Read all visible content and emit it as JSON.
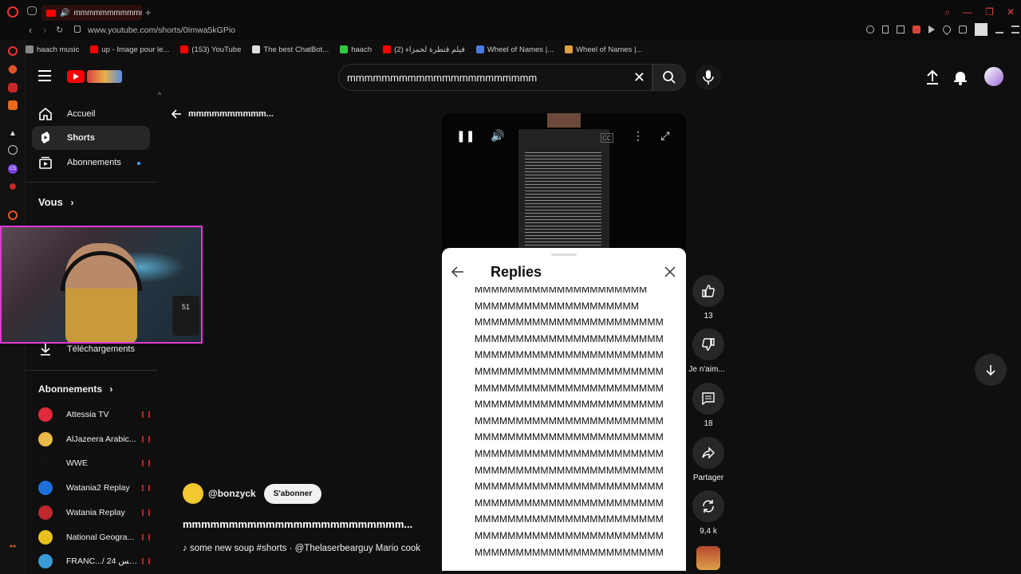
{
  "browser": {
    "tab_title": "mmmmmmmmmmmm",
    "url": "www.youtube.com/shorts/0Imwa5kGPio",
    "bookmarks": [
      {
        "label": "haach music",
        "color": "#888888"
      },
      {
        "label": "up - Image pour le...",
        "color": "#ff0000"
      },
      {
        "label": "(153) YouTube",
        "color": "#ff0000"
      },
      {
        "label": "The best ChatBot...",
        "color": "#dddddd"
      },
      {
        "label": "haach",
        "color": "#2ecc40"
      },
      {
        "label": "فيلم قنطرة لحمزاء (2)",
        "color": "#ff0000"
      },
      {
        "label": "Wheel of Names |...",
        "color": "#4a7de0"
      },
      {
        "label": "Wheel of Names |...",
        "color": "#e0a040"
      }
    ]
  },
  "header": {
    "search_query": "mmmmmmmmmmmmmmmmmmmmmm"
  },
  "sidebar": {
    "items": [
      {
        "label": "Accueil"
      },
      {
        "label": "Shorts"
      },
      {
        "label": "Abonnements"
      }
    ],
    "you_label": "Vous",
    "downloads_label": "Téléchargements",
    "subscriptions_label": "Abonnements",
    "channels": [
      {
        "name": "Attessia TV",
        "color": "#e0293a"
      },
      {
        "name": "AlJazeera Arabic...",
        "color": "#e9b949"
      },
      {
        "name": "WWE",
        "color": "#111111"
      },
      {
        "name": "Watania2 Replay",
        "color": "#1e6fd9"
      },
      {
        "name": "Watania Replay",
        "color": "#c0282d"
      },
      {
        "name": "National Geogra...",
        "color": "#e8c21c"
      },
      {
        "name": "FRANC.../ قرانس 24",
        "color": "#3a9bd6"
      }
    ]
  },
  "webcam": {
    "device_text": "51"
  },
  "short": {
    "back_title": "mmmmmmmmmm...",
    "channel_handle": "@bonzyck",
    "subscribe_label": "S'abonner",
    "title": "mmmmmmmmmmmmmmmmmmmmmmmm...",
    "description": "♪ some new soup #shorts · @Thelaserbearguy    Mario cook"
  },
  "replies_panel": {
    "title": "Replies",
    "lines": [
      "MMMMMMMMMMMMMMMMMMMMM",
      "MMMMMMMMMMMMMMMMMMMM",
      "MMMMMMMMMMMMMMMMMMMMMMM",
      "MMMMMMMMMMMMMMMMMMMMMMM",
      "MMMMMMMMMMMMMMMMMMMMMMM",
      "MMMMMMMMMMMMMMMMMMMMMMM",
      "MMMMMMMMMMMMMMMMMMMMMMM",
      "MMMMMMMMMMMMMMMMMMMMMMM",
      "MMMMMMMMMMMMMMMMMMMMMMM",
      "MMMMMMMMMMMMMMMMMMMMMMM",
      "MMMMMMMMMMMMMMMMMMMMMMM",
      "MMMMMMMMMMMMMMMMMMMMMMM",
      "MMMMMMMMMMMMMMMMMMMMMMM",
      "MMMMMMMMMMMMMMMMMMMMMMM",
      "MMMMMMMMMMMMMMMMMMMMMMM",
      "MMMMMMMMMMMMMMMMMMMMMMM",
      "MMMMMMMMMMMMMMMMMMMMMMM"
    ]
  },
  "actions": {
    "likes": "13",
    "dislike_label": "Je n'aim...",
    "comments": "18",
    "share_label": "Partager",
    "remix_count": "9,4 k"
  }
}
